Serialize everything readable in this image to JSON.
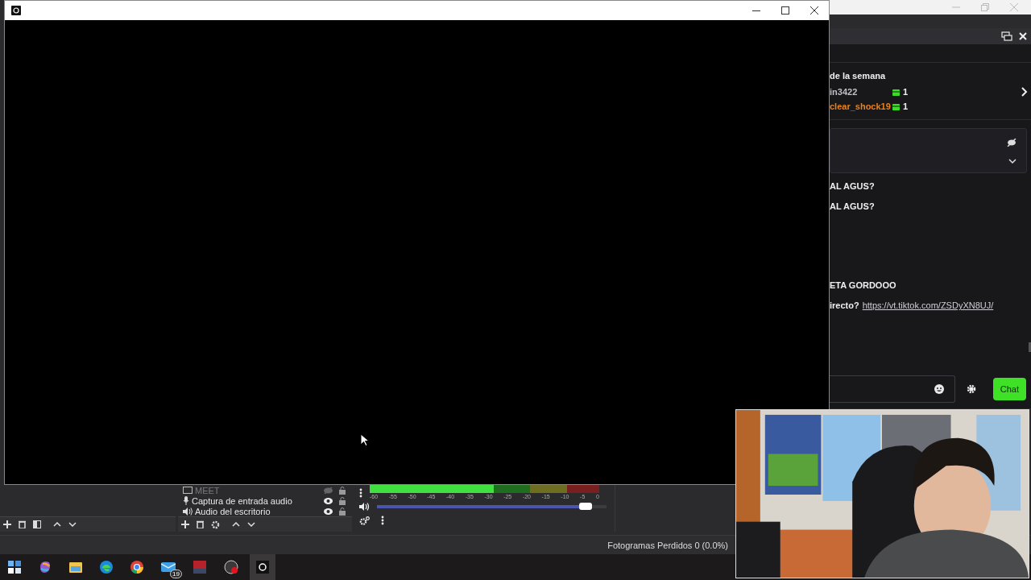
{
  "chat": {
    "leaderboard_title": "de la semana",
    "leaders": [
      {
        "name": "in3422",
        "color": "#bfbfc6",
        "count": "1"
      },
      {
        "name": "clear_shock19",
        "color": "#e8821e",
        "count": "1"
      }
    ],
    "messages": [
      {
        "text": "AL AGUS?"
      },
      {
        "text": "AL AGUS?"
      },
      {
        "text": "ETA GORDOOO"
      },
      {
        "text": "irecto?",
        "link": "https://vt.tiktok.com/ZSDyXN8UJ/"
      }
    ],
    "send_button": "Chat"
  },
  "sources": [
    {
      "name": "MEET",
      "kind": "display",
      "visible": false
    },
    {
      "name": "Captura de entrada audio",
      "kind": "mic",
      "visible": true
    },
    {
      "name": "Audio del escritorio",
      "kind": "speaker",
      "visible": true
    }
  ],
  "mixer": {
    "meter": {
      "level": 0.54
    },
    "ticks": [
      "-60",
      "-55",
      "-50",
      "-45",
      "-40",
      "-35",
      "-30",
      "-25",
      "-20",
      "-15",
      "-10",
      "-5",
      "0"
    ],
    "volume": {
      "level": 0.91
    }
  },
  "status_bar": {
    "dropped_frames": "Fotogramas Perdidos 0 (0.0%)"
  },
  "taskbar": {
    "mail_badge": "19"
  }
}
